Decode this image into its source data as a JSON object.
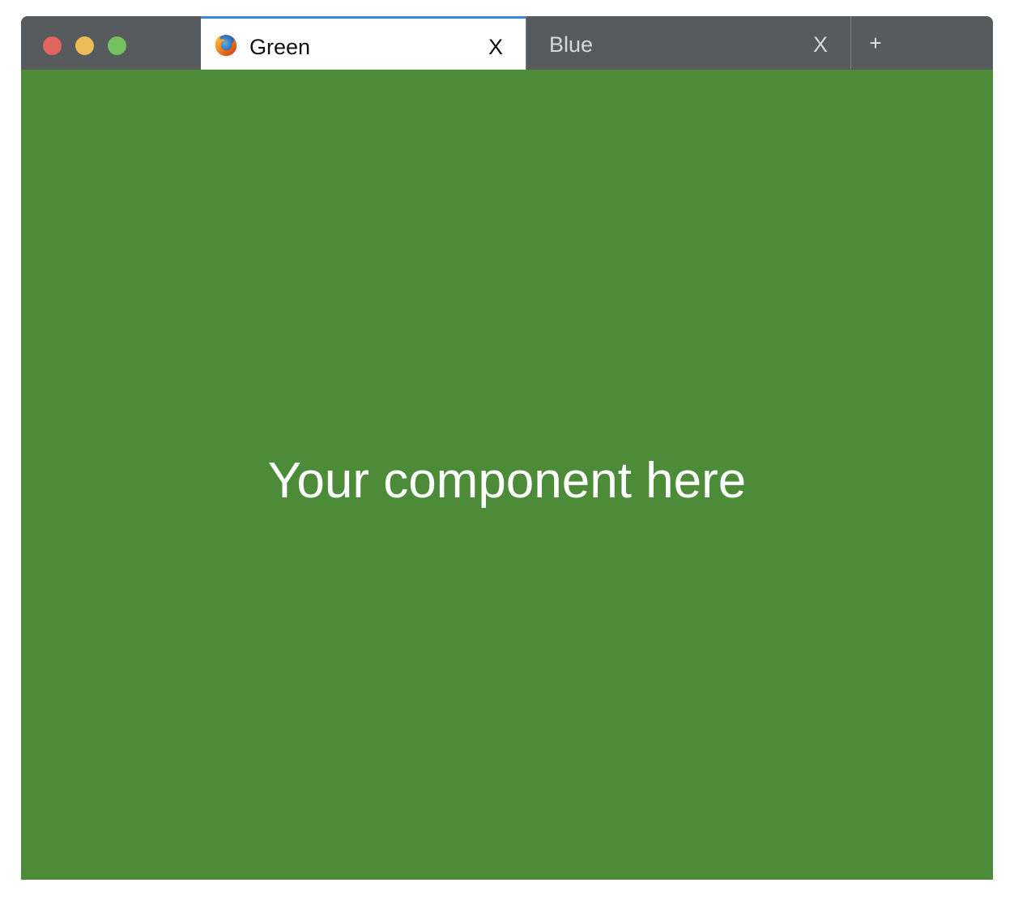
{
  "window": {
    "controls": {
      "close_color": "#e0645f",
      "minimize_color": "#eabd5a",
      "zoom_color": "#74c15f"
    }
  },
  "tabs": [
    {
      "title": "Green",
      "close_label": "X",
      "icon": "firefox-icon",
      "active": true,
      "accent": "#3b86e8"
    },
    {
      "title": "Blue",
      "close_label": "X",
      "active": false
    }
  ],
  "new_tab_label": "+",
  "content": {
    "text": "Your component here",
    "background": "#4c8b37"
  }
}
